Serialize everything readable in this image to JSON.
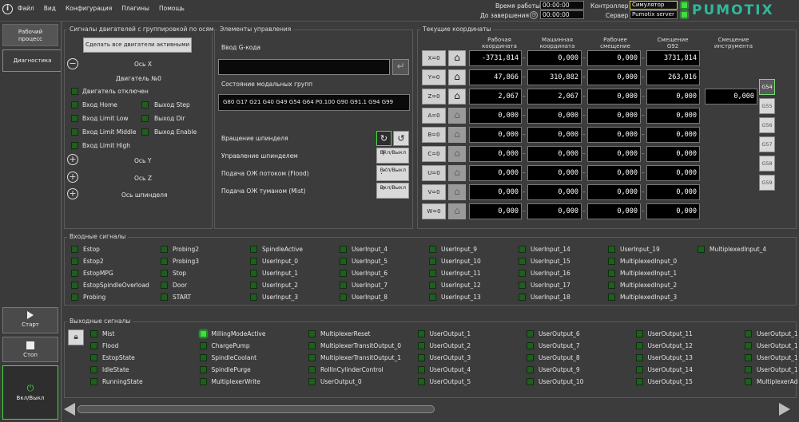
{
  "menu": {
    "items": [
      "Файл",
      "Вид",
      "Конфигурация",
      "Плагины",
      "Помощь"
    ]
  },
  "topbar": {
    "work_time_label": "Время работы",
    "work_time": "00:00:00",
    "to_end_label": "До завершения",
    "to_end": "00:00:00",
    "controller_label": "Контроллер",
    "controller_value": "Симулятор",
    "server_label": "Сервер",
    "server_value": "Pumotix server",
    "logo": "PUMOTIX"
  },
  "nav": {
    "work": "Рабочий процесс",
    "diag": "Диагностика",
    "start": "Старт",
    "stop": "Стоп",
    "power": "Вкл/Выкл"
  },
  "axes_group": {
    "title": "Сигналы двигателей с группировкой по осям",
    "enable_all": "Сделать все двигатели активными",
    "axis_x": "Ось X",
    "motor": "Двигатель №0",
    "motor_off": "Двигатель отключен",
    "signals": [
      "Вход Home",
      "Выход Step",
      "Вход Limit Low",
      "Выход Dir",
      "Вход Limit Middle",
      "Выход Enable",
      "Вход Limit High"
    ],
    "axis_y": "Ось Y",
    "axis_z": "Ось Z",
    "axis_spindle": "Ось шпинделя"
  },
  "controls": {
    "title": "Элементы управления",
    "gcode_label": "Ввод G-кода",
    "modal_label": "Состояние модальных групп",
    "modal_value": "G80 G17 G21 G40 G49 G54 G64 P0.100 G90 G91.1 G94 G99",
    "spindle_rot": "Вращение шпинделя",
    "spindle_ctl": "Управление шпинделем",
    "flood": "Подача ОЖ потоком (Flood)",
    "mist": "Подача ОЖ туманом (Mist)",
    "onoff": "Вкл/Выкл"
  },
  "coords": {
    "title": "Текущие координаты",
    "headers": [
      "Рабочая координата",
      "Машинная координата",
      "Рабочее смещение",
      "Смещение G92",
      "Смещение инструмента"
    ],
    "rows": [
      {
        "axis": "X=0",
        "work": "-3731,814",
        "machine": "0,000",
        "offset": "0,000",
        "g92": "3731,814"
      },
      {
        "axis": "Y=0",
        "work": "47,866",
        "machine": "310,882",
        "offset": "0,000",
        "g92": "263,016"
      },
      {
        "axis": "Z=0",
        "work": "2,067",
        "machine": "2,067",
        "offset": "0,000",
        "g92": "0,000",
        "tool": "0,000"
      },
      {
        "axis": "A=0",
        "work": "0,000",
        "machine": "0,000",
        "offset": "0,000",
        "g92": "0,000"
      },
      {
        "axis": "B=0",
        "work": "0,000",
        "machine": "0,000",
        "offset": "0,000",
        "g92": "0,000"
      },
      {
        "axis": "C=0",
        "work": "0,000",
        "machine": "0,000",
        "offset": "0,000",
        "g92": "0,000"
      },
      {
        "axis": "U=0",
        "work": "0,000",
        "machine": "0,000",
        "offset": "0,000",
        "g92": "0,000"
      },
      {
        "axis": "V=0",
        "work": "0,000",
        "machine": "0,000",
        "offset": "0,000",
        "g92": "0,000"
      },
      {
        "axis": "W=0",
        "work": "0,000",
        "machine": "0,000",
        "offset": "0,000",
        "g92": "0,000"
      }
    ],
    "gcodes": [
      "G54",
      "G55",
      "G56",
      "G57",
      "G58",
      "G59"
    ]
  },
  "inputs": {
    "title": "Входные сигналы",
    "columns": [
      [
        "Estop",
        "Estop2",
        "EstopMPG",
        "EstopSpindleOverload",
        "Probing"
      ],
      [
        "Probing2",
        "Probing3",
        "Stop",
        "Door",
        "START"
      ],
      [
        "SpindleActive",
        "UserInput_0",
        "UserInput_1",
        "UserInput_2",
        "UserInput_3"
      ],
      [
        "UserInput_4",
        "UserInput_5",
        "UserInput_6",
        "UserInput_7",
        "UserInput_8"
      ],
      [
        "UserInput_9",
        "UserInput_10",
        "UserInput_11",
        "UserInput_12",
        "UserInput_13"
      ],
      [
        "UserInput_14",
        "UserInput_15",
        "UserInput_16",
        "UserInput_17",
        "UserInput_18"
      ],
      [
        "UserInput_19",
        "MultiplexedInput_0",
        "MultiplexedInput_1",
        "MultiplexedInput_2",
        "MultiplexedInput_3"
      ],
      [
        "MultiplexedInput_4"
      ]
    ]
  },
  "outputs": {
    "title": "Выходные сигналы",
    "columns": [
      [
        "Mist",
        "Flood",
        "EstopState",
        "IdleState",
        "RunningState"
      ],
      [
        "MillingModeActive",
        "ChargePump",
        "SpindleCoolant",
        "SpindlePurge",
        "MultiplexerWrite"
      ],
      [
        "MultiplexerReset",
        "MultiplexerTransitOutput_0",
        "MultiplexerTransitOutput_1",
        "RollInCylinderControl",
        "UserOutput_0"
      ],
      [
        "UserOutput_1",
        "UserOutput_2",
        "UserOutput_3",
        "UserOutput_4",
        "UserOutput_5"
      ],
      [
        "UserOutput_6",
        "UserOutput_7",
        "UserOutput_8",
        "UserOutput_9",
        "UserOutput_10"
      ],
      [
        "UserOutput_11",
        "UserOutput_12",
        "UserOutput_13",
        "UserOutput_14",
        "UserOutput_15"
      ],
      [
        "UserOutput_1",
        "UserOutput_1",
        "UserOutput_1",
        "UserOutput_1",
        "MultiplexerAd"
      ]
    ],
    "active": "MillingModeActive"
  },
  "colors": {
    "accent": "#3ee03e",
    "led_off": "#1f5e1f",
    "logo": "#2fb89a",
    "controller_bg": "#f2d600"
  }
}
